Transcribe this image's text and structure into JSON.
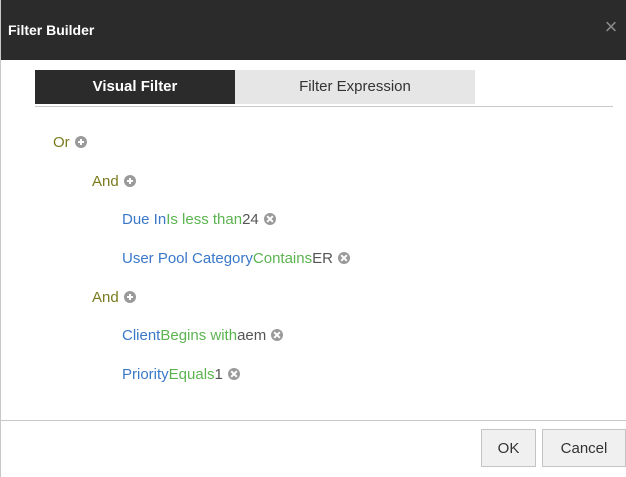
{
  "dialog": {
    "title": "Filter Builder",
    "close_glyph": "×"
  },
  "tabs": [
    {
      "label": "Visual Filter",
      "active": true
    },
    {
      "label": "Filter Expression",
      "active": false
    }
  ],
  "tree": {
    "root": {
      "label": "Or"
    },
    "groups": [
      {
        "label": "And",
        "conditions": [
          {
            "field": "Due In",
            "operator": "Is less than",
            "value": "24"
          },
          {
            "field": "User Pool Category",
            "operator": "Contains",
            "value": "ER"
          }
        ]
      },
      {
        "label": "And",
        "conditions": [
          {
            "field": "Client",
            "operator": "Begins with",
            "value": "aem"
          },
          {
            "field": "Priority",
            "operator": "Equals",
            "value": "1"
          }
        ]
      }
    ]
  },
  "footer": {
    "ok_label": "OK",
    "cancel_label": "Cancel"
  },
  "colors": {
    "titlebar": "#2b2b2b",
    "group": "#7a7a1f",
    "field": "#3a78c8",
    "operator": "#5bb450"
  }
}
